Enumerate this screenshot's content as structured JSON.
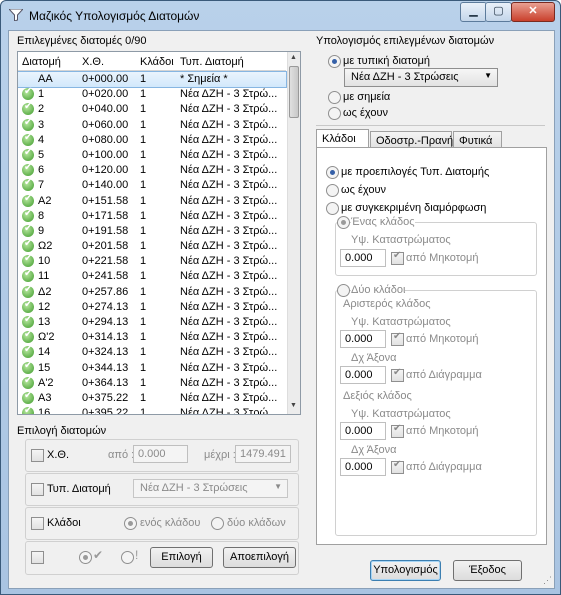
{
  "window": {
    "title": "Μαζικός Υπολογισμός Διατομών",
    "min": "▁",
    "max": "▢",
    "close": "✕"
  },
  "list": {
    "label": "Επιλεγμένες διατομές 0/90",
    "headers": [
      "Διατομή",
      "Χ.Θ.",
      "Κλάδοι",
      "Τυπ. Διατομή"
    ],
    "rows": [
      {
        "name": "ΑΑ",
        "ch": "0+000.00",
        "br": "1",
        "type": "* Σημεία *"
      },
      {
        "name": "1",
        "ch": "0+020.00",
        "br": "1",
        "type": "Νέα ΔΖΗ - 3 Στρώ..."
      },
      {
        "name": "2",
        "ch": "0+040.00",
        "br": "1",
        "type": "Νέα ΔΖΗ - 3 Στρώ..."
      },
      {
        "name": "3",
        "ch": "0+060.00",
        "br": "1",
        "type": "Νέα ΔΖΗ - 3 Στρώ..."
      },
      {
        "name": "4",
        "ch": "0+080.00",
        "br": "1",
        "type": "Νέα ΔΖΗ - 3 Στρώ..."
      },
      {
        "name": "5",
        "ch": "0+100.00",
        "br": "1",
        "type": "Νέα ΔΖΗ - 3 Στρώ..."
      },
      {
        "name": "6",
        "ch": "0+120.00",
        "br": "1",
        "type": "Νέα ΔΖΗ - 3 Στρώ..."
      },
      {
        "name": "7",
        "ch": "0+140.00",
        "br": "1",
        "type": "Νέα ΔΖΗ - 3 Στρώ..."
      },
      {
        "name": "Α2",
        "ch": "0+151.58",
        "br": "1",
        "type": "Νέα ΔΖΗ - 3 Στρώ..."
      },
      {
        "name": "8",
        "ch": "0+171.58",
        "br": "1",
        "type": "Νέα ΔΖΗ - 3 Στρώ..."
      },
      {
        "name": "9",
        "ch": "0+191.58",
        "br": "1",
        "type": "Νέα ΔΖΗ - 3 Στρώ..."
      },
      {
        "name": "Ω2",
        "ch": "0+201.58",
        "br": "1",
        "type": "Νέα ΔΖΗ - 3 Στρώ..."
      },
      {
        "name": "10",
        "ch": "0+221.58",
        "br": "1",
        "type": "Νέα ΔΖΗ - 3 Στρώ..."
      },
      {
        "name": "11",
        "ch": "0+241.58",
        "br": "1",
        "type": "Νέα ΔΖΗ - 3 Στρώ..."
      },
      {
        "name": "Δ2",
        "ch": "0+257.86",
        "br": "1",
        "type": "Νέα ΔΖΗ - 3 Στρώ..."
      },
      {
        "name": "12",
        "ch": "0+274.13",
        "br": "1",
        "type": "Νέα ΔΖΗ - 3 Στρώ..."
      },
      {
        "name": "13",
        "ch": "0+294.13",
        "br": "1",
        "type": "Νέα ΔΖΗ - 3 Στρώ..."
      },
      {
        "name": "Ω'2",
        "ch": "0+314.13",
        "br": "1",
        "type": "Νέα ΔΖΗ - 3 Στρώ..."
      },
      {
        "name": "14",
        "ch": "0+324.13",
        "br": "1",
        "type": "Νέα ΔΖΗ - 3 Στρώ..."
      },
      {
        "name": "15",
        "ch": "0+344.13",
        "br": "1",
        "type": "Νέα ΔΖΗ - 3 Στρώ..."
      },
      {
        "name": "Α'2",
        "ch": "0+364.13",
        "br": "1",
        "type": "Νέα ΔΖΗ - 3 Στρώ..."
      },
      {
        "name": "Α3",
        "ch": "0+375.22",
        "br": "1",
        "type": "Νέα ΔΖΗ - 3 Στρώ..."
      },
      {
        "name": "16",
        "ch": "0+395.22",
        "br": "1",
        "type": "Νέα ΔΖΗ - 3 Στρώ..."
      }
    ]
  },
  "selection": {
    "label": "Επιλογή διατομών",
    "ch_label": "Χ.Θ.",
    "from_label": "από :",
    "from_value": "0.000",
    "to_label": "μέχρι :",
    "to_value": "1479.491",
    "type_label": "Τυπ. Διατομή",
    "type_value": "Νέα ΔΖΗ - 3 Στρώσεις",
    "branches_label": "Κλάδοι",
    "one_branch": "ενός κλάδου",
    "two_branches": "δύο κλάδων",
    "select_button": "Επιλογή",
    "deselect_button": "Αποεπιλογή"
  },
  "calc": {
    "label": "Υπολογισμός επιλεγμένων διατομών",
    "opt_typical": "με τυπική διατομή",
    "typical_value": "Νέα ΔΖΗ - 3 Στρώσεις",
    "opt_points": "με σημεία",
    "opt_asis": "ως έχουν"
  },
  "tabs": [
    "Κλάδοι",
    "Οδοστρ.-Πρανή",
    "Φυτικά"
  ],
  "branches": {
    "opt_defaults": "με προεπιλογές Τυπ. Διατομής",
    "opt_asis": "ως έχουν",
    "opt_specific": "με συγκεκριμένη διαμόρφωση",
    "one_branch": "Ένας κλάδος",
    "elev_label": "Υψ. Καταστρώματος",
    "one_value": "0.000",
    "from_profile": "από Μηκοτομή",
    "two_branches": "Δύο κλάδοι",
    "left_label": "Αριστερός κλάδος",
    "left_elev_value": "0.000",
    "axis_label": "Δχ Άξονα",
    "left_axis_value": "0.000",
    "from_diagram": "από Διάγραμμα",
    "right_label": "Δεξιός κλάδος",
    "right_elev_value": "0.000",
    "right_axis_value": "0.000"
  },
  "buttons": {
    "compute": "Υπολογισμός",
    "exit": "Έξοδος"
  },
  "colors": {
    "accent": "#3560a8",
    "selection": "#d2e8fb",
    "check": "#3d9a2a"
  }
}
